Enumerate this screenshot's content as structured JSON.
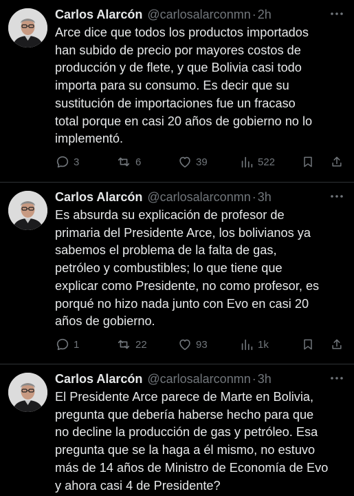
{
  "tweets": [
    {
      "author_name": "Carlos Alarcón",
      "handle": "@carlosalarconmn",
      "separator": "·",
      "time": "2h",
      "text": "Arce dice que todos los productos importados\nhan subido de precio por mayores costos de\nproducción y de flete, y que Bolivia casi todo\nimporta para su consumo. Es decir que su\nsustitución de importaciones fue un fracaso\ntotal porque en casi 20 años de gobierno no lo\nimplementó.",
      "replies": "3",
      "retweets": "6",
      "likes": "39",
      "views": "522"
    },
    {
      "author_name": "Carlos Alarcón",
      "handle": "@carlosalarconmn",
      "separator": "·",
      "time": "3h",
      "text": "Es absurda su explicación de profesor de\nprimaria del Presidente Arce, los bolivianos ya\nsabemos el problema de la falta de gas,\npetróleo y combustibles; lo que tiene que\nexplicar como Presidente, no como profesor, es\nporqué no hizo nada junto con Evo en casi 20\naños de gobierno.",
      "replies": "1",
      "retweets": "22",
      "likes": "93",
      "views": "1k"
    },
    {
      "author_name": "Carlos Alarcón",
      "handle": "@carlosalarconmn",
      "separator": "·",
      "time": "3h",
      "text": "El Presidente Arce parece de Marte en Bolivia,\npregunta que debería haberse hecho para que\nno decline la producción de gas y petróleo. Esa\npregunta que se la haga a él mismo, no estuvo\nmás de 14 años de Ministro de Economía de Evo\ny ahora casi 4 de Presidente?"
    }
  ],
  "icons": {
    "reply": "reply-icon",
    "retweet": "retweet-icon",
    "like": "heart-icon",
    "views": "views-icon",
    "bookmark": "bookmark-icon",
    "share": "share-icon",
    "more": "more-icon"
  },
  "colors": {
    "background": "#000000",
    "text": "#e7e9ea",
    "secondary": "#71767b",
    "divider": "#2f3336"
  }
}
